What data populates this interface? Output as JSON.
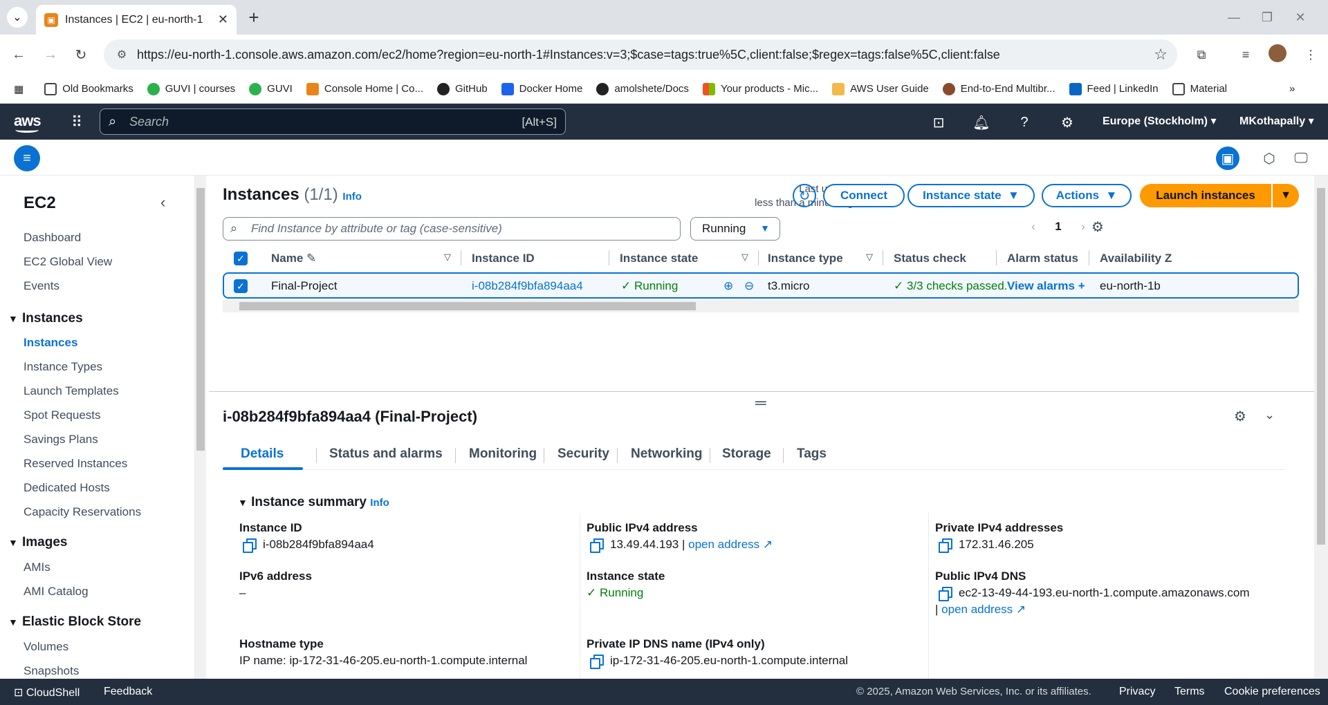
{
  "browser": {
    "tab_title": "Instances | EC2 | eu-north-1",
    "url": "https://eu-north-1.console.aws.amazon.com/ec2/home?region=eu-north-1#Instances:v=3;$case=tags:true%5C,client:false;$regex=tags:false%5C,client:false",
    "bookmarks": [
      "Old Bookmarks",
      "GUVI | courses",
      "GUVI",
      "Console Home | Co...",
      "GitHub",
      "Docker Home",
      "amolshete/Docs",
      "Your products - Mic...",
      "AWS User Guide",
      "End-to-End Multibr...",
      "Feed | LinkedIn",
      "Material"
    ]
  },
  "awsnav": {
    "logo": "aws",
    "search_placeholder": "Search",
    "search_shortcut": "[Alt+S]",
    "region": "Europe (Stockholm) ▾",
    "account": "MKothapally ▾"
  },
  "sidebar": {
    "title": "EC2",
    "top_items": [
      "Dashboard",
      "EC2 Global View",
      "Events"
    ],
    "sections": [
      {
        "label": "Instances",
        "items": [
          "Instances",
          "Instance Types",
          "Launch Templates",
          "Spot Requests",
          "Savings Plans",
          "Reserved Instances",
          "Dedicated Hosts",
          "Capacity Reservations"
        ]
      },
      {
        "label": "Images",
        "items": [
          "AMIs",
          "AMI Catalog"
        ]
      },
      {
        "label": "Elastic Block Store",
        "items": [
          "Volumes",
          "Snapshots"
        ]
      }
    ],
    "active_item": "Instances"
  },
  "instances": {
    "title": "Instances",
    "count": "(1/1)",
    "info": "Info",
    "last_updated_label": "Last updated",
    "last_updated_value": "less than a minute ago",
    "connect": "Connect",
    "instance_state_btn": "Instance state",
    "actions_btn": "Actions",
    "launch_btn": "Launch instances",
    "filter_placeholder": "Find Instance by attribute or tag (case-sensitive)",
    "state_filter": "Running",
    "page": "1",
    "columns": [
      "Name",
      "Instance ID",
      "Instance state",
      "Instance type",
      "Status check",
      "Alarm status",
      "Availability Z"
    ],
    "row": {
      "name": "Final-Project",
      "instance_id": "i-08b284f9bfa894aa4",
      "state": "Running",
      "type": "t3.micro",
      "status_check": "3/3 checks passed.",
      "alarm": "View alarms",
      "az": "eu-north-1b"
    }
  },
  "details": {
    "title": "i-08b284f9bfa894aa4 (Final-Project)",
    "tabs": [
      "Details",
      "Status and alarms",
      "Monitoring",
      "Security",
      "Networking",
      "Storage",
      "Tags"
    ],
    "summary_title": "Instance summary",
    "summary_info": "Info",
    "fields": {
      "instance_id_label": "Instance ID",
      "instance_id_value": "i-08b284f9bfa894aa4",
      "ipv6_label": "IPv6 address",
      "ipv6_value": "–",
      "hostname_label": "Hostname type",
      "hostname_value": "IP name: ip-172-31-46-205.eu-north-1.compute.internal",
      "public_ipv4_label": "Public IPv4 address",
      "public_ipv4_value": "13.49.44.193 |",
      "open_address": "open address",
      "state_label": "Instance state",
      "state_value": "Running",
      "private_dns_label": "Private IP DNS name (IPv4 only)",
      "private_dns_value": "ip-172-31-46-205.eu-north-1.compute.internal",
      "private_ipv4_label": "Private IPv4 addresses",
      "private_ipv4_value": "172.31.46.205",
      "public_dns_label": "Public IPv4 DNS",
      "public_dns_value": "ec2-13-49-44-193.eu-north-1.compute.amazonaws.com",
      "public_dns_sep": "|",
      "open_address_2": "open address"
    }
  },
  "footer": {
    "cloudshell": "CloudShell",
    "feedback": "Feedback",
    "copyright": "© 2025, Amazon Web Services, Inc. or its affiliates.",
    "privacy": "Privacy",
    "terms": "Terms",
    "cookies": "Cookie preferences"
  },
  "colors": {
    "accent": "#0972d3",
    "nav_bg": "#232f3e",
    "launch": "#ff9900",
    "success": "#037f0c"
  }
}
